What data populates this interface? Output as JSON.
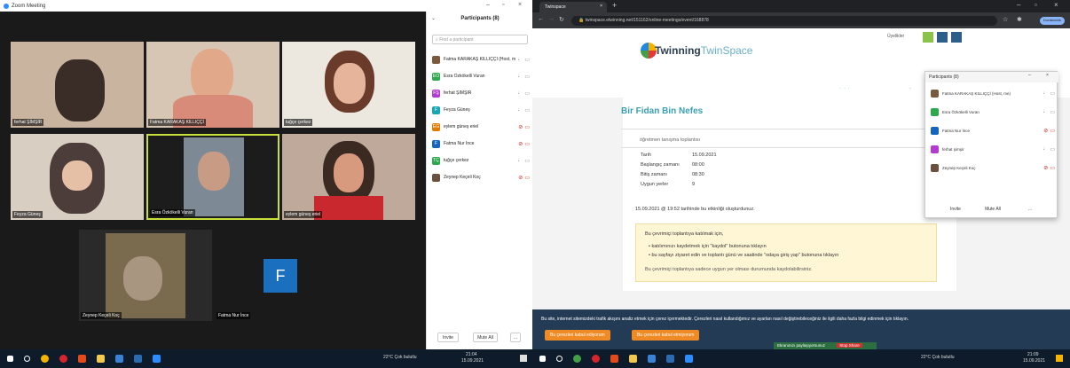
{
  "zoom": {
    "window_title": "Zoom Meeting",
    "tiles": [
      {
        "name": "ferhat ŞİMŞİR"
      },
      {
        "name": "Fatma KARAKAŞ KILLIÇÇİ"
      },
      {
        "name": "tuğçe çerkez"
      },
      {
        "name": "Feyza Güneş"
      },
      {
        "name": "Esra Özkökelli Vuran"
      },
      {
        "name": "eylem güneş eriel"
      },
      {
        "name": "Zeynep Keçeli Koç"
      },
      {
        "name": "Fatma Nur İnce"
      }
    ],
    "self_tile_letter": "F",
    "panel": {
      "title": "Participants (8)",
      "search_placeholder": "Find a participant",
      "participants": [
        {
          "initials": "",
          "name": "Fatma KARAKAŞ KILLIÇÇİ (Host, me)",
          "color": "#7a5a3a",
          "muted": false
        },
        {
          "initials": "EO",
          "name": "Esra Özkökelli Vuran",
          "color": "#2ea84d",
          "muted": false
        },
        {
          "initials": "FŞ",
          "name": "ferhat ŞİMŞİR",
          "color": "#b43bd0",
          "muted": false
        },
        {
          "initials": "F",
          "name": "Feyza Güneş",
          "color": "#17a6b5",
          "muted": false
        },
        {
          "initials": "EG",
          "name": "eylem güneş eriel",
          "color": "#e07b00",
          "muted": true
        },
        {
          "initials": "F",
          "name": "Fatma Nur İnce",
          "color": "#1565c0",
          "muted": true
        },
        {
          "initials": "TÇ",
          "name": "tuğçe çerkez",
          "color": "#2ea84d",
          "muted": false
        },
        {
          "initials": "",
          "name": "Zeynep Keçeli Koç",
          "color": "#6b5040",
          "muted": true
        }
      ],
      "invite_label": "Invite",
      "mute_all_label": "Mute All",
      "more_label": "..."
    }
  },
  "taskbar_left": {
    "weather": "22°C Çok bulutlu",
    "time": "21:04",
    "date": "15.09.2021"
  },
  "browser": {
    "tab_title": "Twinspace",
    "new_tab": "+",
    "url": "twinspace.etwinning.net/151162/online-meetings/event/168878",
    "profile": "Duraklatıldı",
    "logo_main": "Twinning",
    "logo_sub": "TwinSpace",
    "menu": [
      "ANA SAYFA",
      "SAYFALAR",
      "MATERYALLER",
      "FORUM",
      "ÇEVRİMİÇİ TOPLANTILAR",
      "ÜYELER"
    ],
    "header_user": "Üyelikler",
    "page_title": "Bir Fidan Bin Nefes",
    "meeting_subtitle": "öğretmen tanışma toplantısı",
    "details": [
      {
        "label": "Tarih",
        "value": "15.09.2021"
      },
      {
        "label": "Başlangıç zamanı",
        "value": "08:00"
      },
      {
        "label": "Bitiş zamanı",
        "value": "08:30"
      },
      {
        "label": "Uygun yerler",
        "value": "9"
      }
    ],
    "created_note": "15.09.2021 @ 19:52 tarihinde bu etkinliği oluşturdunuz.",
    "yellow_title": "Bu çevrimiçi toplantıya katılmak için,",
    "yellow_items": [
      "katılımınızı kaydetmek için \"kaydol\" butonuna tıklayın",
      "bu sayfayı ziyaret edin ve toplantı günü ve saatinde \"odaya giriş yap\" butonuna tıklayın"
    ],
    "yellow_footer": "Bu çevrimiçi toplantıya sadece uygun yer olması durumunda kaydolabilirsiniz.",
    "cookie_text": "Bu site, internet sitemizdeki trafik akışını analiz etmek için çerez içermektedir. Çerezleri nasıl kullandığımız ve ayarları nasıl değiştirebileceğiniz ile ilgili daha fazla bilgi edinmek için tıklayın.",
    "accept_label": "Bu çerezleri kabul ediyorum",
    "reject_label": "Bu çerezleri kabul etmiyorum"
  },
  "float_panel": {
    "title": "Participants (8)",
    "rows": [
      {
        "name": "Fatma KARAKAŞ KILLIÇÇİ (Host, me)",
        "color": "#7a5a3a",
        "muted": false
      },
      {
        "name": "Esra Özkökelli Vuran",
        "color": "#2ea84d",
        "muted": false
      },
      {
        "name": "Fatma Nur İnce",
        "color": "#1565c0",
        "muted": true
      },
      {
        "name": "ferhat şimşir",
        "color": "#b43bd0",
        "muted": false
      },
      {
        "name": "Zeynep Keçeli Koç",
        "color": "#6b5040",
        "muted": true
      }
    ],
    "invite_label": "Invite",
    "mute_all_label": "Mute All",
    "more_label": "..."
  },
  "sharing_bar": {
    "text": "Ekranınızı paylaşıyorsunuz",
    "stop_label": "Stop Share"
  },
  "taskbar_right": {
    "weather": "22°C Çok bulutlu",
    "time": "21:09",
    "date": "15.09.2021"
  }
}
